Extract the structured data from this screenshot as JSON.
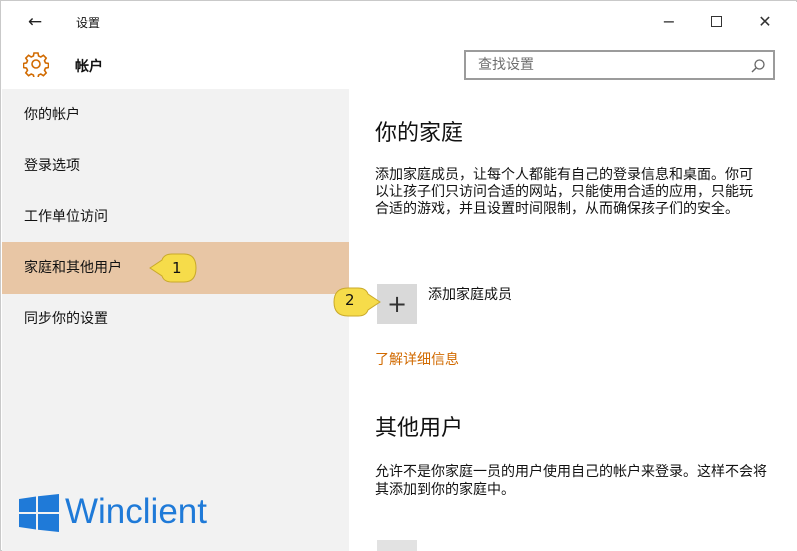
{
  "window": {
    "back_icon": "back-arrow-icon",
    "title": "设置",
    "controls": {
      "minimize": "−",
      "maximize": "maximize-icon",
      "close": "✕"
    }
  },
  "header": {
    "icon": "gear-icon",
    "title": "帐户",
    "search_placeholder": "查找设置",
    "search_icon": "search-icon"
  },
  "sidebar": {
    "items": [
      {
        "label": "你的帐户",
        "active": false
      },
      {
        "label": "登录选项",
        "active": false
      },
      {
        "label": "工作单位访问",
        "active": false
      },
      {
        "label": "家庭和其他用户",
        "active": true
      },
      {
        "label": "同步你的设置",
        "active": false
      }
    ]
  },
  "callouts": [
    {
      "number": "1"
    },
    {
      "number": "2"
    }
  ],
  "logo": {
    "text": "Winclient"
  },
  "main": {
    "family": {
      "heading": "你的家庭",
      "description": "添加家庭成员，让每个人都能有自己的登录信息和桌面。你可以让孩子们只访问合适的网站，只能使用合适的应用，只能玩合适的游戏，并且设置时间限制，从而确保孩子们的安全。",
      "add_label": "添加家庭成员",
      "learn_more": "了解详细信息"
    },
    "others": {
      "heading": "其他用户",
      "description": "允许不是你家庭一员的用户使用自己的帐户来登录。这样不会将其添加到你的家庭中。"
    }
  },
  "colors": {
    "accent_link": "#d16a00",
    "active_nav": "#e8c6a5",
    "sidebar_bg": "#f2f2f2",
    "callout_yellow": "#f6dc4a",
    "logo_blue": "#1f7ad8"
  }
}
